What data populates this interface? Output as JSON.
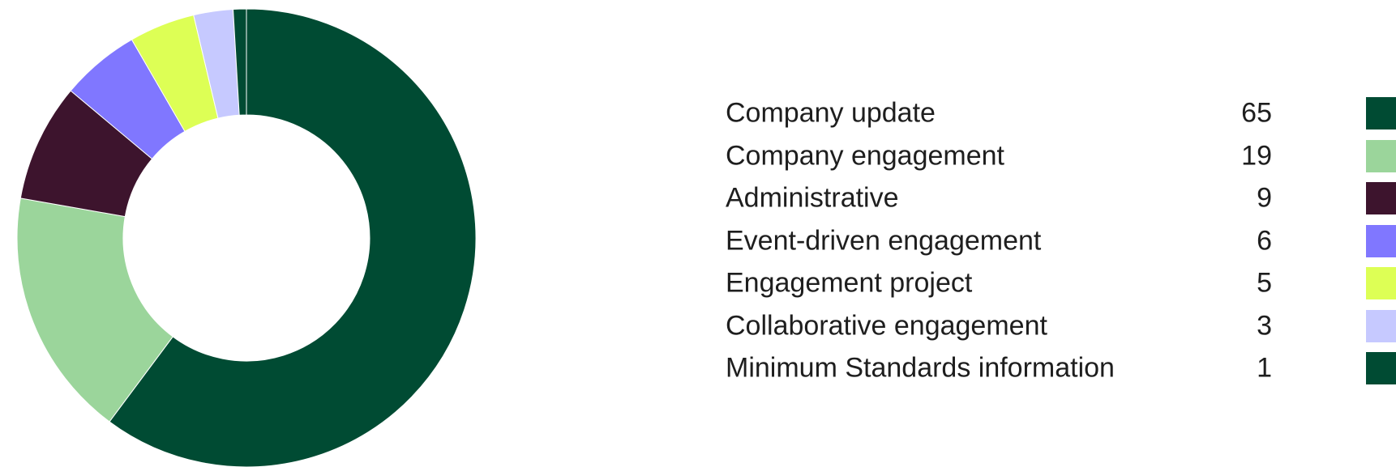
{
  "chart_data": {
    "type": "pie",
    "donut": true,
    "title": "",
    "categories": [
      "Company update",
      "Company engagement",
      "Administrative",
      "Event-driven engagement",
      "Engagement project",
      "Collaborative engagement",
      "Minimum Standards information"
    ],
    "values": [
      65,
      19,
      9,
      6,
      5,
      3,
      1
    ],
    "colors": [
      "#004b33",
      "#9bd59b",
      "#3d142d",
      "#8077ff",
      "#ddff55",
      "#c6c9ff",
      "#004b33"
    ],
    "legend_position": "right"
  }
}
